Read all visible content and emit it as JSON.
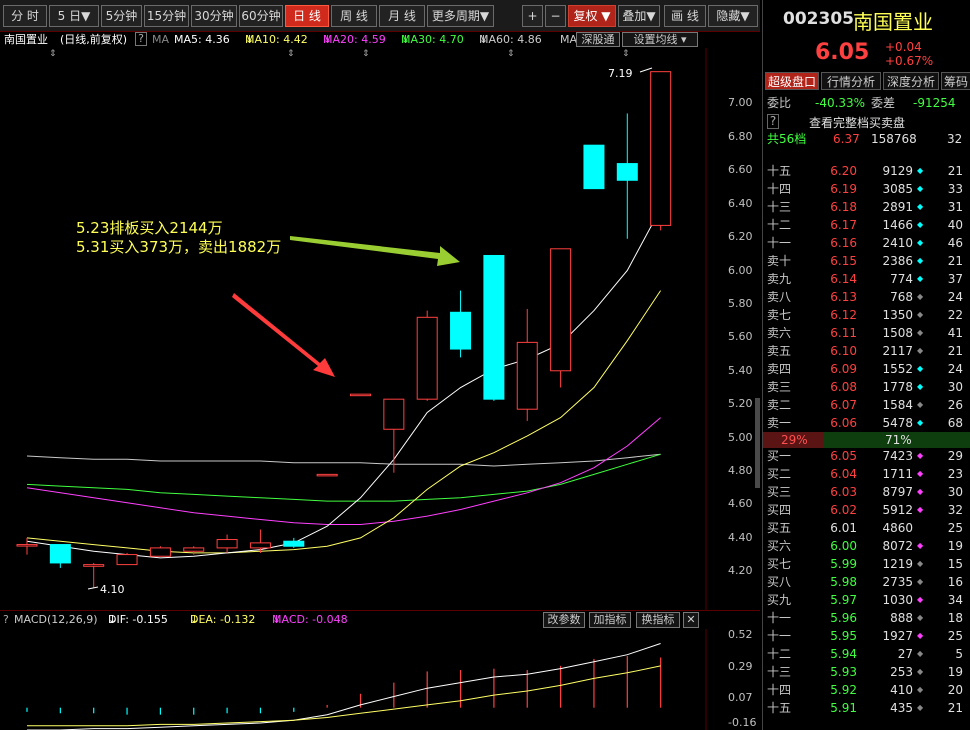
{
  "toolbar": {
    "period_buttons": [
      "分 时",
      "5 日",
      "5分钟",
      "15分钟",
      "30分钟",
      "60分钟",
      "日 线",
      "周 线",
      "月 线",
      "更多周期"
    ],
    "active_period": "日 线",
    "plus": "+",
    "minus": "−",
    "fuquan": "复权",
    "diejia": "叠加",
    "huaxian": "画 线",
    "yincang": "隐藏"
  },
  "info_bar": {
    "stock_name": "南国置业",
    "mode": "(日线,前复权)",
    "help": "?",
    "ma_label": "MA",
    "ma5": "MA5: 4.36",
    "ma10": "MA10: 4.42",
    "ma20": "MA20: 4.59",
    "ma30": "MA30: 4.70",
    "ma60": "MA60: 4.86",
    "ma_more": "MA",
    "btn_shenjutong": "深股通",
    "btn_settings": "设置均线"
  },
  "colors": {
    "up": "#ff4040",
    "down": "#00ffff",
    "ma5": "#ffffff",
    "ma10": "#ffff66",
    "ma20": "#ff40ff",
    "ma30": "#40ff40",
    "ma60": "#c8c8c8",
    "annotation_text": "#ffff55",
    "green_arrow": "#9acd32",
    "red_arrow": "#ff3b3b"
  },
  "annotations": {
    "line1": "5.23排板买入2144万",
    "line2": "5.31买入373万，卖出1882万",
    "high_label": "7.19",
    "low_label": "4.10"
  },
  "price_axis": [
    "7.00",
    "6.80",
    "6.60",
    "6.40",
    "6.20",
    "6.00",
    "5.80",
    "5.60",
    "5.40",
    "5.20",
    "5.00",
    "4.80",
    "4.60",
    "4.40",
    "4.20"
  ],
  "chart_data": [
    {
      "type": "candlestick",
      "title": "南国置业 (日线,前复权)",
      "candles": [
        {
          "o": 4.36,
          "c": 4.36,
          "h": 4.4,
          "l": 4.3
        },
        {
          "o": 4.36,
          "c": 4.25,
          "h": 4.36,
          "l": 4.22
        },
        {
          "o": 4.23,
          "c": 4.24,
          "h": 4.25,
          "l": 4.1
        },
        {
          "o": 4.24,
          "c": 4.3,
          "h": 4.31,
          "l": 4.24
        },
        {
          "o": 4.29,
          "c": 4.34,
          "h": 4.35,
          "l": 4.29
        },
        {
          "o": 4.32,
          "c": 4.34,
          "h": 4.35,
          "l": 4.3
        },
        {
          "o": 4.34,
          "c": 4.39,
          "h": 4.42,
          "l": 4.31
        },
        {
          "o": 4.34,
          "c": 4.37,
          "h": 4.45,
          "l": 4.31
        },
        {
          "o": 4.38,
          "c": 4.35,
          "h": 4.4,
          "l": 4.34
        },
        {
          "o": 4.78,
          "c": 4.78,
          "h": 4.78,
          "l": 4.78
        },
        {
          "o": 5.26,
          "c": 5.26,
          "h": 5.26,
          "l": 5.26
        },
        {
          "o": 5.05,
          "c": 5.23,
          "h": 5.23,
          "l": 4.79
        },
        {
          "o": 5.23,
          "c": 5.72,
          "h": 5.76,
          "l": 5.22
        },
        {
          "o": 5.75,
          "c": 5.53,
          "h": 5.88,
          "l": 5.48
        },
        {
          "o": 6.09,
          "c": 5.23,
          "h": 6.09,
          "l": 5.22
        },
        {
          "o": 5.17,
          "c": 5.57,
          "h": 5.77,
          "l": 5.1
        },
        {
          "o": 5.4,
          "c": 6.13,
          "h": 6.13,
          "l": 5.3
        },
        {
          "o": 6.75,
          "c": 6.49,
          "h": 6.75,
          "l": 6.49
        },
        {
          "o": 6.64,
          "c": 6.54,
          "h": 6.94,
          "l": 6.19
        },
        {
          "o": 6.27,
          "c": 7.19,
          "h": 7.19,
          "l": 6.24
        }
      ],
      "ma5": [
        4.38,
        4.35,
        4.32,
        4.3,
        4.28,
        4.29,
        4.31,
        4.33,
        4.37,
        4.47,
        4.64,
        4.87,
        5.15,
        5.3,
        5.41,
        5.47,
        5.56,
        5.76,
        6.0,
        6.37
      ],
      "ma10": [
        4.4,
        4.38,
        4.36,
        4.34,
        4.32,
        4.31,
        4.31,
        4.32,
        4.33,
        4.35,
        4.4,
        4.52,
        4.69,
        4.83,
        4.91,
        5.01,
        5.12,
        5.3,
        5.58,
        5.88
      ],
      "ma20": [
        4.7,
        4.67,
        4.64,
        4.61,
        4.58,
        4.55,
        4.53,
        4.51,
        4.49,
        4.48,
        4.48,
        4.5,
        4.53,
        4.57,
        4.62,
        4.67,
        4.73,
        4.82,
        4.95,
        5.12
      ],
      "ma30": [
        4.72,
        4.71,
        4.7,
        4.69,
        4.67,
        4.66,
        4.65,
        4.64,
        4.63,
        4.62,
        4.62,
        4.62,
        4.63,
        4.64,
        4.66,
        4.68,
        4.72,
        4.78,
        4.84,
        4.9
      ],
      "ma60": [
        4.89,
        4.88,
        4.87,
        4.87,
        4.86,
        4.86,
        4.86,
        4.86,
        4.85,
        4.85,
        4.85,
        4.84,
        4.84,
        4.84,
        4.83,
        4.84,
        4.85,
        4.86,
        4.88,
        4.9
      ],
      "ylim": [
        4.1,
        7.2
      ]
    },
    {
      "type": "bar",
      "title": "MACD(12,26,9)",
      "ticks": [
        "0.52",
        "0.29",
        "0.07",
        "-0.16"
      ],
      "macd": [
        -0.03,
        -0.04,
        -0.04,
        -0.05,
        -0.05,
        -0.05,
        -0.04,
        -0.04,
        -0.03,
        0.02,
        0.1,
        0.18,
        0.26,
        0.27,
        0.28,
        0.27,
        0.3,
        0.35,
        0.37,
        0.36
      ],
      "dif": [
        -0.16,
        -0.16,
        -0.15,
        -0.15,
        -0.14,
        -0.13,
        -0.12,
        -0.11,
        -0.09,
        -0.05,
        0.02,
        0.08,
        0.14,
        0.18,
        0.22,
        0.24,
        0.28,
        0.33,
        0.38,
        0.46
      ],
      "dea": [
        -0.13,
        -0.13,
        -0.13,
        -0.13,
        -0.12,
        -0.12,
        -0.11,
        -0.1,
        -0.09,
        -0.07,
        -0.04,
        -0.01,
        0.02,
        0.05,
        0.09,
        0.12,
        0.16,
        0.21,
        0.25,
        0.3
      ],
      "ylim": [
        -0.16,
        0.55
      ]
    }
  ],
  "macd_bar": {
    "help": "?",
    "title": "MACD(12,26,9)",
    "dif": "DIF: -0.155",
    "dea": "DEA: -0.132",
    "macd": "MACD: -0.048",
    "btn_params": "改参数",
    "btn_add": "加指标",
    "btn_switch": "换指标",
    "close": "✕"
  },
  "right_panel": {
    "code": "002305",
    "name": "南国置业",
    "price": "6.05",
    "change": "+0.04",
    "change_pct": "+0.67%",
    "tabs": [
      "超级盘口",
      "行情分析",
      "深度分析",
      "筹码"
    ],
    "weibi_label": "委比",
    "weibi": "-40.33%",
    "weicha_label": "委差",
    "weicha": "-91254",
    "help": "?",
    "full_book": "查看完整档买卖盘",
    "total_label": "共56档",
    "total_price": "6.37",
    "total_vol": "158768",
    "total_cnt": "32",
    "ratio_sell": "29%",
    "ratio_buy": "71%",
    "asks": [
      {
        "label": "十五",
        "price": "6.20",
        "vol": "9129",
        "cnt": "21",
        "dot": "#00ffff"
      },
      {
        "label": "十四",
        "price": "6.19",
        "vol": "3085",
        "cnt": "33",
        "dot": "#00ffff"
      },
      {
        "label": "十三",
        "price": "6.18",
        "vol": "2891",
        "cnt": "31",
        "dot": "#00ffff"
      },
      {
        "label": "十二",
        "price": "6.17",
        "vol": "1466",
        "cnt": "40",
        "dot": "#00ffff"
      },
      {
        "label": "十一",
        "price": "6.16",
        "vol": "2410",
        "cnt": "46",
        "dot": "#00ffff"
      },
      {
        "label": "卖十",
        "price": "6.15",
        "vol": "2386",
        "cnt": "21",
        "dot": "#00ffff"
      },
      {
        "label": "卖九",
        "price": "6.14",
        "vol": "774",
        "cnt": "37",
        "dot": "#00ffff"
      },
      {
        "label": "卖八",
        "price": "6.13",
        "vol": "768",
        "cnt": "24",
        "dot": "#888888"
      },
      {
        "label": "卖七",
        "price": "6.12",
        "vol": "1350",
        "cnt": "22",
        "dot": "#888888"
      },
      {
        "label": "卖六",
        "price": "6.11",
        "vol": "1508",
        "cnt": "41",
        "dot": "#888888"
      },
      {
        "label": "卖五",
        "price": "6.10",
        "vol": "2117",
        "cnt": "21",
        "dot": "#888888"
      },
      {
        "label": "卖四",
        "price": "6.09",
        "vol": "1552",
        "cnt": "24",
        "dot": "#00ffff"
      },
      {
        "label": "卖三",
        "price": "6.08",
        "vol": "1778",
        "cnt": "30",
        "dot": "#00ffff"
      },
      {
        "label": "卖二",
        "price": "6.07",
        "vol": "1584",
        "cnt": "26",
        "dot": "#888888"
      },
      {
        "label": "卖一",
        "price": "6.06",
        "vol": "5478",
        "cnt": "68",
        "dot": "#00ffff"
      }
    ],
    "bids": [
      {
        "label": "买一",
        "price": "6.05",
        "vol": "7423",
        "cnt": "29",
        "dot": "#ff40ff"
      },
      {
        "label": "买二",
        "price": "6.04",
        "vol": "1711",
        "cnt": "23",
        "dot": "#ff40ff"
      },
      {
        "label": "买三",
        "price": "6.03",
        "vol": "8797",
        "cnt": "30",
        "dot": "#ff40ff"
      },
      {
        "label": "买四",
        "price": "6.02",
        "vol": "5912",
        "cnt": "32",
        "dot": "#ff40ff"
      },
      {
        "label": "买五",
        "price": "6.01",
        "vol": "4860",
        "cnt": "25",
        "dot": ""
      },
      {
        "label": "买六",
        "price": "6.00",
        "vol": "8072",
        "cnt": "19",
        "dot": "#ff40ff"
      },
      {
        "label": "买七",
        "price": "5.99",
        "vol": "1219",
        "cnt": "15",
        "dot": "#888888"
      },
      {
        "label": "买八",
        "price": "5.98",
        "vol": "2735",
        "cnt": "16",
        "dot": "#888888"
      },
      {
        "label": "买九",
        "price": "5.97",
        "vol": "1030",
        "cnt": "34",
        "dot": "#ff40ff"
      },
      {
        "label": "十一",
        "price": "5.96",
        "vol": "888",
        "cnt": "18",
        "dot": "#888888"
      },
      {
        "label": "十一",
        "price": "5.95",
        "vol": "1927",
        "cnt": "25",
        "dot": "#ff40ff"
      },
      {
        "label": "十二",
        "price": "5.94",
        "vol": "27",
        "cnt": "5",
        "dot": "#888888"
      },
      {
        "label": "十三",
        "price": "5.93",
        "vol": "253",
        "cnt": "19",
        "dot": "#888888"
      },
      {
        "label": "十四",
        "price": "5.92",
        "vol": "410",
        "cnt": "20",
        "dot": "#888888"
      },
      {
        "label": "十五",
        "price": "5.91",
        "vol": "435",
        "cnt": "21",
        "dot": "#888888"
      }
    ]
  }
}
